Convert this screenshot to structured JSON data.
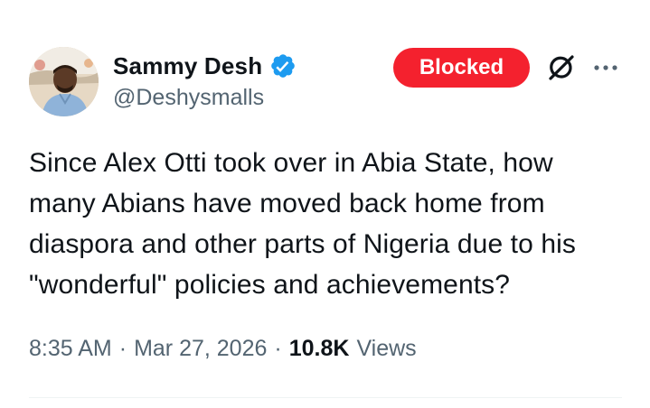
{
  "author": {
    "display_name": "Sammy Desh",
    "handle": "@Deshysmalls",
    "verified": true,
    "verified_color": "#1d9bf0"
  },
  "actions": {
    "blocked_label": "Blocked",
    "blocked_color": "#f4212e",
    "grok_icon": "grok-icon",
    "more_icon": "more-horizontal-icon"
  },
  "tweet": {
    "text": "Since Alex Otti took over in Abia State, how many Abians have moved back home from diaspora and other parts of Nigeria due to his \"wonderful\" policies and achievements?",
    "time": "8:35 AM",
    "separator": "·",
    "date": "Mar 27, 2026",
    "views_count": "10.8K",
    "views_label": "Views"
  }
}
